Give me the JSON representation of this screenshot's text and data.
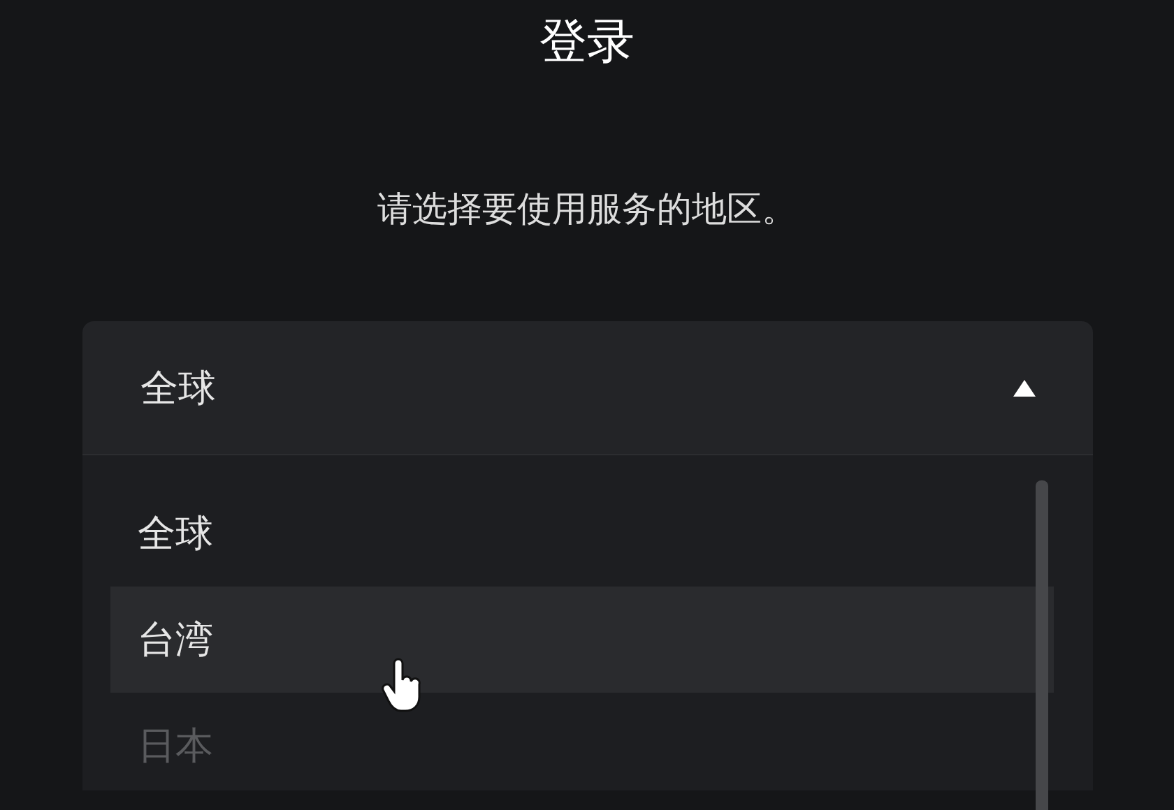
{
  "title": "登录",
  "prompt": "请选择要使用服务的地区。",
  "region_select": {
    "value": "全球",
    "expanded": true,
    "options": [
      {
        "label": "全球",
        "highlighted": false
      },
      {
        "label": "台湾",
        "highlighted": true
      },
      {
        "label": "日本",
        "highlighted": false
      }
    ]
  }
}
